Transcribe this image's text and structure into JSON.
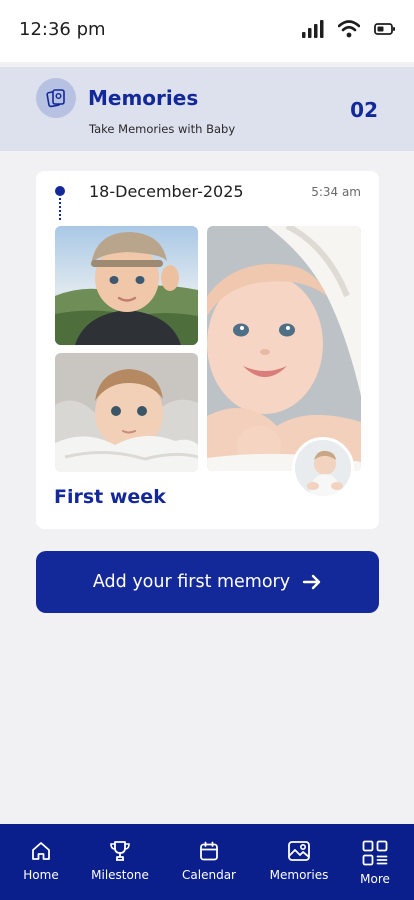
{
  "status_bar": {
    "time": "12:36 pm",
    "icons": [
      "signal-icon",
      "wifi-icon",
      "battery-icon"
    ]
  },
  "header": {
    "icon": "photo-album-icon",
    "title": "Memories",
    "subtitle": "Take Memories with Baby",
    "count": "02"
  },
  "memory_card": {
    "date": "18-December-2025",
    "time": "5:34 am",
    "photos": [
      "baby-photo-cap",
      "baby-photo-blanket",
      "baby-photo-smiling",
      "baby-photo-thumb"
    ],
    "caption": "First week"
  },
  "cta": {
    "label": "Add your first memory",
    "icon": "arrow-right-icon"
  },
  "bottom_nav": {
    "items": [
      {
        "label": "Home",
        "icon": "home-icon"
      },
      {
        "label": "Milestone",
        "icon": "trophy-icon"
      },
      {
        "label": "Calendar",
        "icon": "calendar-icon"
      },
      {
        "label": "Memories",
        "icon": "gallery-icon"
      },
      {
        "label": "More",
        "icon": "grid-icon"
      }
    ]
  },
  "colors": {
    "primary": "#13299a",
    "nav_background": "#0a1f8c",
    "header_background": "#dde1ee",
    "page_background": "#f1f1f3"
  }
}
